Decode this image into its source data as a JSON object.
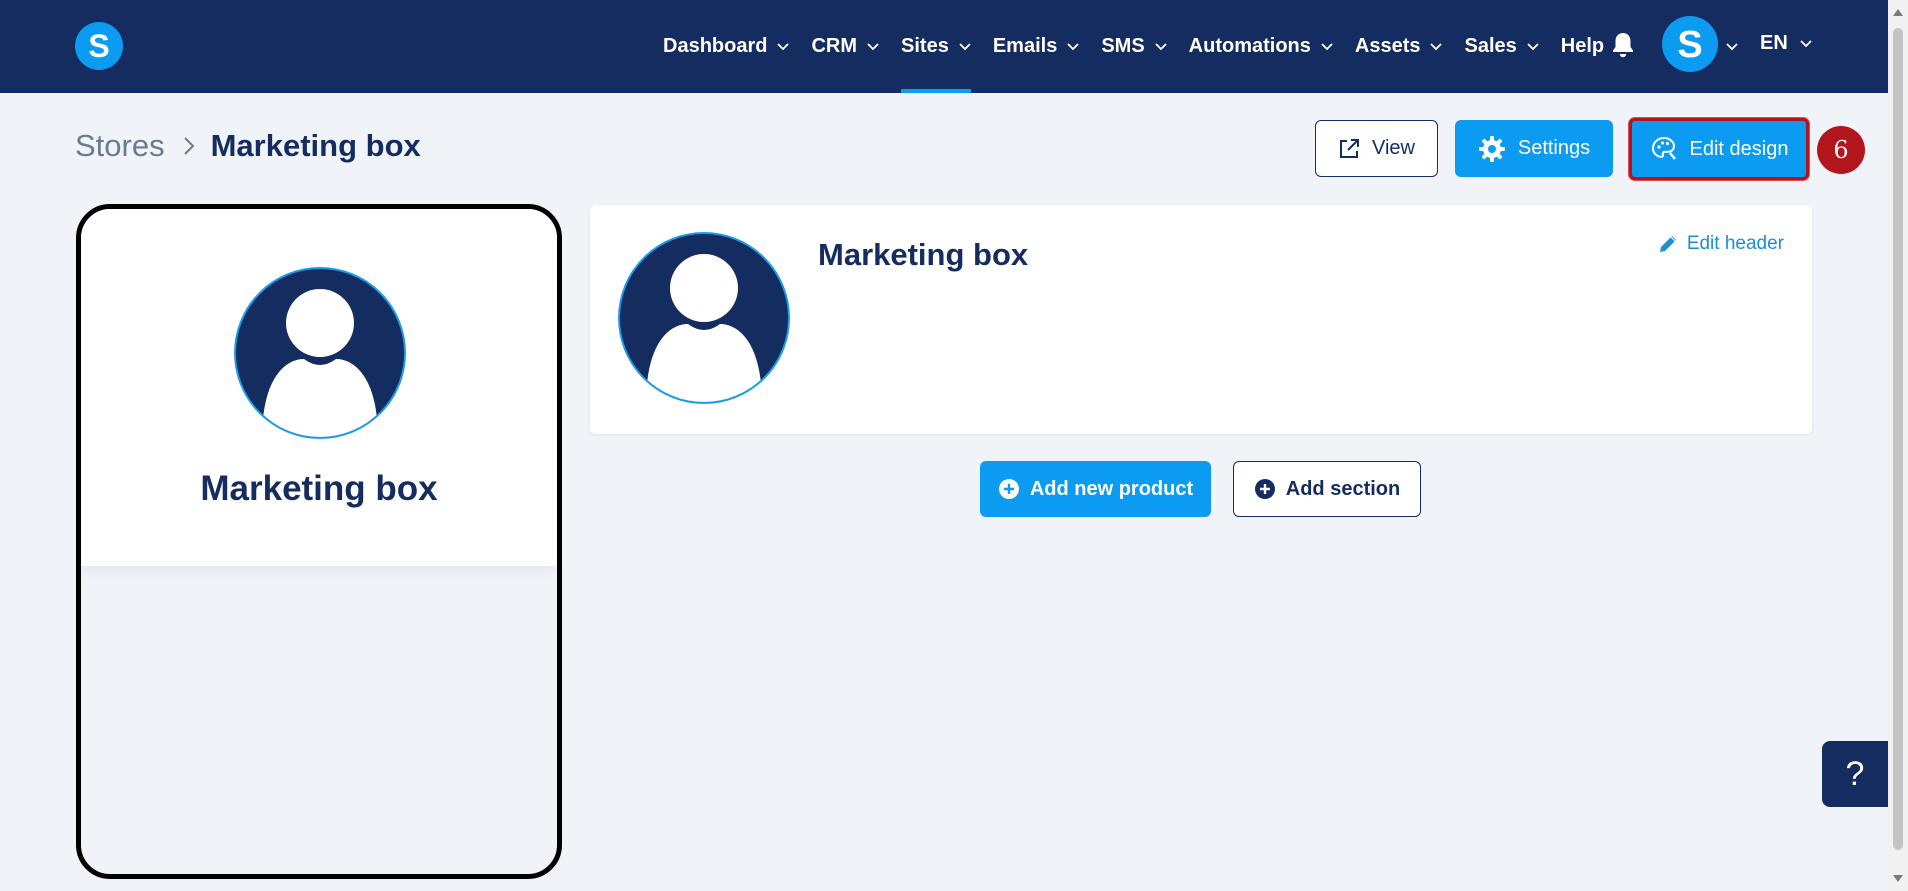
{
  "brand": {
    "logo_letter": "S"
  },
  "nav": {
    "items": [
      {
        "label": "Dashboard",
        "has_dropdown": true,
        "active": false
      },
      {
        "label": "CRM",
        "has_dropdown": true,
        "active": false
      },
      {
        "label": "Sites",
        "has_dropdown": true,
        "active": true
      },
      {
        "label": "Emails",
        "has_dropdown": true,
        "active": false
      },
      {
        "label": "SMS",
        "has_dropdown": true,
        "active": false
      },
      {
        "label": "Automations",
        "has_dropdown": true,
        "active": false
      },
      {
        "label": "Assets",
        "has_dropdown": true,
        "active": false
      },
      {
        "label": "Sales",
        "has_dropdown": true,
        "active": false
      },
      {
        "label": "Help",
        "has_dropdown": false,
        "active": false
      }
    ],
    "bell_icon": "bell-icon",
    "user_avatar_letter": "S",
    "language": "EN"
  },
  "breadcrumb": {
    "parent": "Stores",
    "current": "Marketing box"
  },
  "actions": {
    "view_label": "View",
    "settings_label": "Settings",
    "edit_design_label": "Edit design",
    "step_number": "6"
  },
  "preview": {
    "title": "Marketing box"
  },
  "header_card": {
    "title": "Marketing box",
    "edit_label": "Edit header"
  },
  "content_actions": {
    "add_product_label": "Add new product",
    "add_section_label": "Add section"
  },
  "help": {
    "label": "?"
  },
  "colors": {
    "nav_bg": "#142c5f",
    "accent": "#0b9bf0",
    "page_bg": "#f0f4f9",
    "highlight": "#b2151c"
  }
}
